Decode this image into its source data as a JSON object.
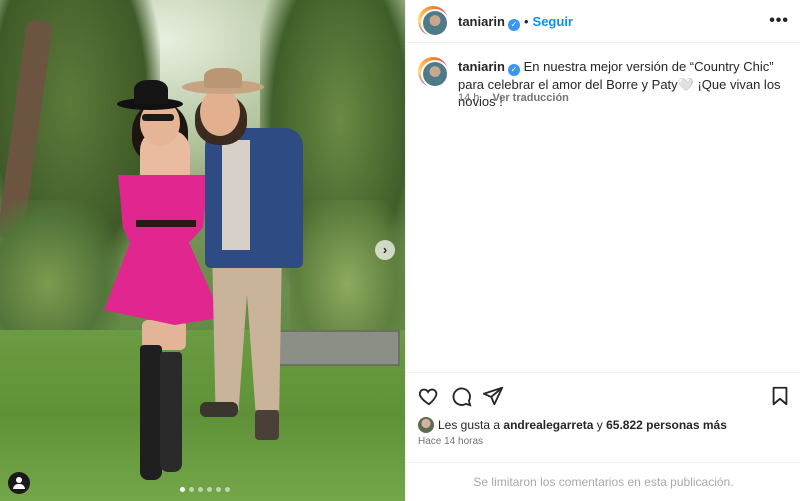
{
  "post": {
    "username": "taniarin",
    "verified_mark": "✓",
    "follow_label": "Seguir",
    "bullet": "•",
    "more_icon": "more-icon",
    "caption": "En nuestra mejor versión de “Country Chic” para celebrar el amor del Borre y Paty🤍 ¡Que vivan los novios !",
    "age": "14 h",
    "translate_label": "Ver traducción",
    "likes_prefix": "Les gusta a",
    "likes_user": "andrealegarreta",
    "likes_middle": "y",
    "likes_count": "65.822 personas más",
    "time_ago": "Hace 14 horas",
    "comments_disabled": "Se limitaron los comentarios en esta publicación.",
    "carousel_next": "›",
    "carousel_dots": 6,
    "carousel_active_index": 0
  },
  "colors": {
    "accent": "#0095f6",
    "verified": "#3897f0",
    "text": "#262626",
    "muted": "#737373"
  }
}
